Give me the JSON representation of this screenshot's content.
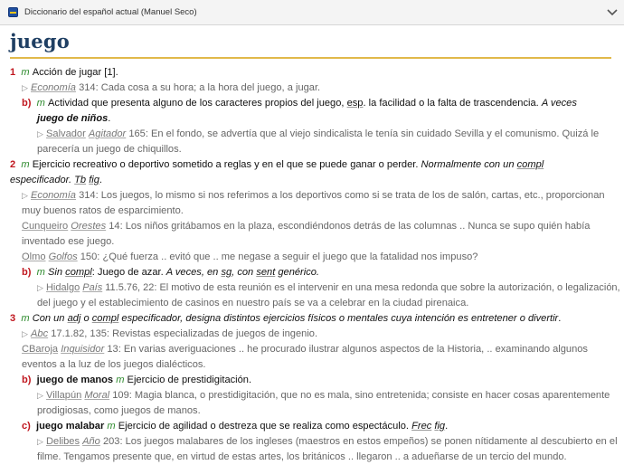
{
  "window": {
    "title": "Diccionario del español actual (Manuel Seco)"
  },
  "entry": {
    "headword": "juego"
  },
  "senses": {
    "s1": {
      "num": "1",
      "gram": "m",
      "text": "Acción de jugar [1].",
      "cite1": {
        "source": "Economía",
        "text": "314: Cada cosa a su hora; a la hora del juego, a jugar."
      },
      "b": {
        "label": "b)",
        "gram": "m",
        "text_a": "Actividad que presenta alguno de los caracteres propios del juego,",
        "abbr": "esp",
        "text_b": ". la facilidad o la falta de trascendencia.",
        "italic": "A veces",
        "line2_bold_it": "juego de niños",
        "line2_end": ".",
        "cite": {
          "source": "Salvador",
          "source_it": "Agitador",
          "text_a": "165: En el fondo, se advertía que al viejo sindicalista le tenía sin cuidado Sevilla y el comunismo. Quizá le",
          "text_b": "parecería un juego de chiquillos."
        }
      }
    },
    "s2": {
      "num": "2",
      "gram": "m",
      "text": "Ejercicio recreativo o deportivo sometido a reglas y en el que se puede ganar o perder.",
      "italic": "Normalmente con un",
      "compl": "compl",
      "line2_it": "especificador.",
      "tb": "Tb",
      "fig": "fig",
      "line2_end": ".",
      "cite1": {
        "source": "Economía",
        "text_a": "314: Los juegos, lo mismo si nos referimos a los deportivos como si se trata de los de salón, cartas, etc., proporcionan",
        "text_b": "muy buenos ratos de esparcimiento."
      },
      "cite2": {
        "source": "Cunqueiro",
        "source_it": "Orestes",
        "text_a": "14: Los niños gritábamos en la plaza, escondiéndonos detrás de las columnas .. Nunca se supo quién había",
        "text_b": "inventado ese juego."
      },
      "cite3": {
        "source": "Olmo",
        "source_it": "Golfos",
        "text": "150: ¿Qué fuerza .. evitó que .. me negase a seguir el juego que la fatalidad nos impuso?"
      },
      "b": {
        "label": "b)",
        "gram": "m",
        "sin": "Sin",
        "compl": "compl",
        "text": ": Juego de azar.",
        "italic": "A veces, en",
        "sg": "sg",
        "italic2": ", con",
        "sent": "sent",
        "italic3": "genérico.",
        "cite": {
          "source": "Hidalgo",
          "source_it": "País",
          "text_a": "11.5.76, 22: El motivo de esta reunión es el intervenir en una mesa redonda que sobre la autorización, o legalización,",
          "text_b": "del juego y el establecimiento de casinos en nuestro país se va a celebrar en la ciudad pirenaica."
        }
      }
    },
    "s3": {
      "num": "3",
      "gram": "m",
      "con": "Con un",
      "adj": "adj",
      "o": "o",
      "compl": "compl",
      "italic": "especificador, designa distintos ejercicios físicos o mentales cuya intención es entretener o divertir",
      "end": ".",
      "cite1": {
        "source": "Abc",
        "text": "17.1.82, 135: Revistas especializadas de juegos de ingenio."
      },
      "cite2": {
        "source": "CBaroja",
        "source_it": "Inquisidor",
        "text_a": "13: En varias averiguaciones .. he procurado ilustrar algunos aspectos de la Historia, .. examinando algunos",
        "text_b": "eventos a la luz de los juegos dialécticos."
      },
      "b": {
        "label": "b)",
        "bold": "juego de manos",
        "gram": "m",
        "text": "Ejercicio de prestidigitación.",
        "cite": {
          "source": "Villapún",
          "source_it": "Moral",
          "text_a": "109: Magia blanca, o prestidigitación, que no es mala, sino entretenida; consiste en hacer cosas aparentemente",
          "text_b": "prodigiosas, como juegos de manos."
        }
      },
      "c": {
        "label": "c)",
        "bold": "juego malabar",
        "gram": "m",
        "text": "Ejercicio de agilidad o destreza que se realiza como espectáculo.",
        "frec": "Frec",
        "fig": "fig",
        "end": ".",
        "cite": {
          "source": "Delibes",
          "source_it": "Año",
          "text_a": "203: Los juegos malabares de los ingleses (maestros en estos empeños) se ponen nítidamente al descubierto en el",
          "text_b": "filme. Tengamos presente que, en virtud de estas artes, los británicos .. llegaron .. a adueñarse de un tercio del mundo."
        }
      }
    }
  },
  "icons": {
    "app": "dictionary-app-icon",
    "collapse": "chevron-down-icon",
    "citation": "triangle-right-icon"
  },
  "colors": {
    "headword": "#1f3f63",
    "rule": "#e1b94a",
    "sense_number": "#c0161e",
    "grammar": "#2e8b2e",
    "citation": "#666666"
  }
}
